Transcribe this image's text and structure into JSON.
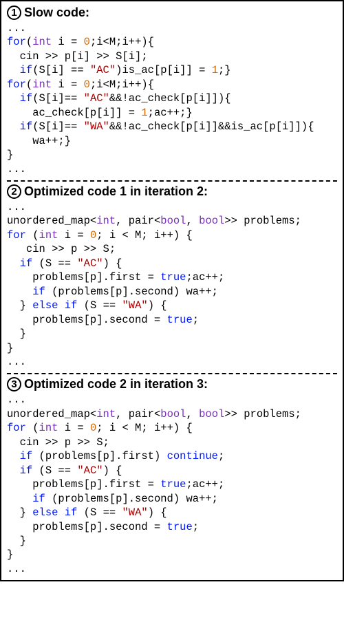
{
  "sections": [
    {
      "badge": "1",
      "title": "Slow code:"
    },
    {
      "badge": "2",
      "title": "Optimized code 1 in iteration 2:"
    },
    {
      "badge": "3",
      "title": "Optimized code 2 in iteration 3:"
    }
  ],
  "code1": {
    "ell1": "...",
    "l1a": "for",
    "l1b": "(",
    "l1c": "int",
    "l1d": " i = ",
    "l1e": "0",
    "l1f": ";i<M;i++){",
    "l2": "  cin >> p[i] >> S[i];",
    "l3a": "  ",
    "l3b": "if",
    "l3c": "(S[i] == ",
    "l3d": "\"AC\"",
    "l3e": ")is_ac[p[i]] = ",
    "l3f": "1",
    "l3g": ";}",
    "l4a": "for",
    "l4b": "(",
    "l4c": "int",
    "l4d": " i = ",
    "l4e": "0",
    "l4f": ";i<M;i++){",
    "l5a": "  ",
    "l5b": "if",
    "l5c": "(S[i]== ",
    "l5d": "\"AC\"",
    "l5e": "&&!ac_check[p[i]]){",
    "l6a": "    ac_check[p[i]] = ",
    "l6b": "1",
    "l6c": ";ac++;}",
    "l7a": "  ",
    "l7b": "if",
    "l7c": "(S[i]== ",
    "l7d": "\"WA\"",
    "l7e": "&&!ac_check[p[i]]&&is_ac[p[i]]){",
    "l8": "    wa++;}",
    "l9": "}",
    "ell2": "..."
  },
  "code2": {
    "ell1": "...",
    "l1a": "unordered_map<",
    "l1b": "int",
    "l1c": ", pair<",
    "l1d": "bool",
    "l1e": ", ",
    "l1f": "bool",
    "l1g": ">> problems;",
    "l2a": "for",
    "l2b": " (",
    "l2c": "int",
    "l2d": " i = ",
    "l2e": "0",
    "l2f": "; i < M; i++) {",
    "l3": "   cin >> p >> S;",
    "l4a": "  ",
    "l4b": "if",
    "l4c": " (S == ",
    "l4d": "\"AC\"",
    "l4e": ") {",
    "l5a": "    problems[p].first = ",
    "l5b": "true",
    "l5c": ";ac++;",
    "l6a": "    ",
    "l6b": "if",
    "l6c": " (problems[p].second) wa++;",
    "l7a": "  } ",
    "l7b": "else",
    "l7c": " ",
    "l7d": "if",
    "l7e": " (S == ",
    "l7f": "\"WA\"",
    "l7g": ") {",
    "l8a": "    problems[p].second = ",
    "l8b": "true",
    "l8c": ";",
    "l9": "  }",
    "l10": "}",
    "ell2": "..."
  },
  "code3": {
    "ell1": "...",
    "l1a": "unordered_map<",
    "l1b": "int",
    "l1c": ", pair<",
    "l1d": "bool",
    "l1e": ", ",
    "l1f": "bool",
    "l1g": ">> problems;",
    "l2a": "for",
    "l2b": " (",
    "l2c": "int",
    "l2d": " i = ",
    "l2e": "0",
    "l2f": "; i < M; i++) {",
    "l3": "  cin >> p >> S;",
    "l4a": "  ",
    "l4b": "if",
    "l4c": " (problems[p].first) ",
    "l4d": "continue",
    "l4e": ";",
    "l5a": "  ",
    "l5b": "if",
    "l5c": " (S == ",
    "l5d": "\"AC\"",
    "l5e": ") {",
    "l6a": "    problems[p].first = ",
    "l6b": "true",
    "l6c": ";ac++;",
    "l7a": "    ",
    "l7b": "if",
    "l7c": " (problems[p].second) wa++;",
    "l8a": "  } ",
    "l8b": "else",
    "l8c": " ",
    "l8d": "if",
    "l8e": " (S == ",
    "l8f": "\"WA\"",
    "l8g": ") {",
    "l9a": "    problems[p].second = ",
    "l9b": "true",
    "l9c": ";",
    "l10": "  }",
    "l11": "}",
    "ell2": "..."
  }
}
